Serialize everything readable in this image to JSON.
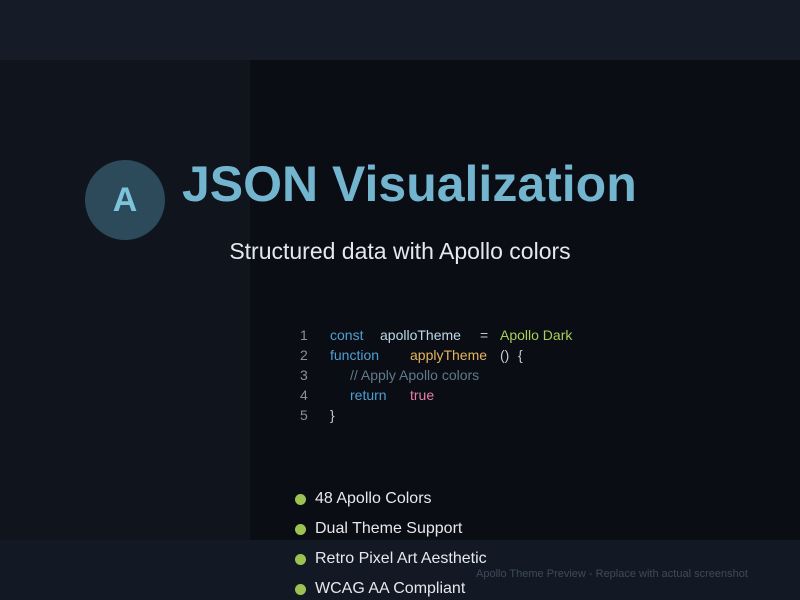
{
  "logo": {
    "letter": "A"
  },
  "title": "JSON Visualization",
  "subtitle": "Structured data with Apollo colors",
  "code": {
    "lines": [
      {
        "number": "1",
        "tokens": [
          "const",
          "apolloTheme",
          "=",
          "Apollo Dark"
        ]
      },
      {
        "number": "2",
        "tokens": [
          "function",
          "applyTheme",
          "()",
          "{"
        ]
      },
      {
        "number": "3",
        "tokens": [
          "// Apply Apollo colors"
        ]
      },
      {
        "number": "4",
        "tokens": [
          "return",
          "true"
        ]
      },
      {
        "number": "5",
        "tokens": [
          "}"
        ]
      }
    ]
  },
  "features": [
    "48 Apollo Colors",
    "Dual Theme Support",
    "Retro Pixel Art Aesthetic",
    "WCAG AA Compliant"
  ],
  "caption": "Apollo Theme Preview - Replace with actual screenshot",
  "colors": {
    "accent": "#73b5cf",
    "bullet": "#9bc253",
    "keyword": "#4f9fd1",
    "string": "#a8cf5a",
    "function": "#e8b45f",
    "boolean": "#e77fa6",
    "comment": "#5f7a8a"
  }
}
